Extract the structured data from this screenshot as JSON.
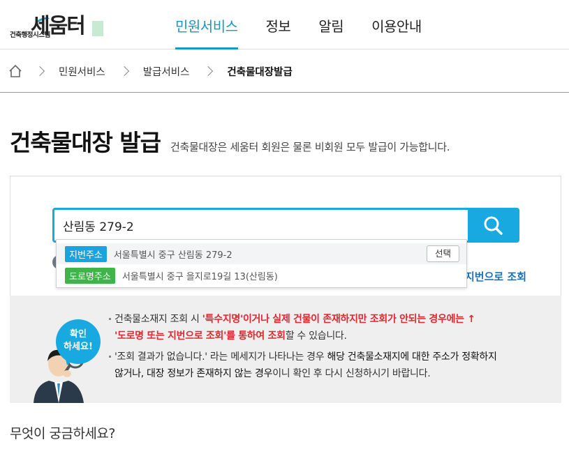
{
  "logo": {
    "main": "세움터",
    "sub": "건축행정시스템"
  },
  "nav": [
    {
      "label": "민원서비스",
      "active": true
    },
    {
      "label": "정보",
      "active": false
    },
    {
      "label": "알림",
      "active": false
    },
    {
      "label": "이용안내",
      "active": false
    }
  ],
  "breadcrumb": [
    "민원서비스",
    "발급서비스",
    "건축물대장발급"
  ],
  "page": {
    "title": "건축물대장 발급",
    "description": "건축물대장은 세움터 회원은 물론 비회원 모두 발급이 가능합니다."
  },
  "search": {
    "value": "산림동 279-2",
    "link_label": "지번으로 조회"
  },
  "autocomplete": [
    {
      "badge": "지번주소",
      "address": "서울특별시 중구 산림동 279-2",
      "action": "선택"
    },
    {
      "badge": "도로명주소",
      "address": "서울특별시 중구 을지로19길 13(산림동)"
    }
  ],
  "notice": {
    "bubble": [
      "확인",
      "하세요!"
    ],
    "line1_a": "건축물소재지 조회 시 ",
    "line1_b": "'특수지명'이거나 실제 건물이 존재하지만 조회가 안되는 경우에는 ↑",
    "line2_a": "'도로명 또는 지번으로 조회'를 통하여 조회",
    "line2_b": "할 수 있습니다.",
    "line3_a": "'조회 결과가 없습니다.' 라는 메세지가 나타나는 경우 ",
    "line3_b": "해당 건축물소재지에 대한 주소가 정확하지",
    "line4_a": "않거나, 대장 정보가 존재하지 않는 경우",
    "line4_b": "이니 확인 후 다시 신청하시기 바랍니다."
  },
  "faq_title": "무엇이 궁금하세요?",
  "colors": {
    "accent": "#19a9e1",
    "green": "#3eb549",
    "red": "#e0262e",
    "link": "#1572b8"
  }
}
